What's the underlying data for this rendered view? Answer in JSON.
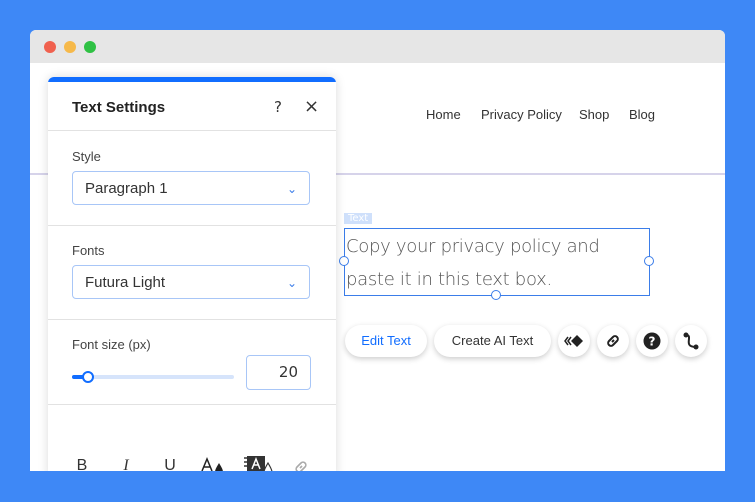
{
  "browser": {
    "controls": [
      "close",
      "minimize",
      "maximize"
    ]
  },
  "site": {
    "nav": [
      "Home",
      "Privacy Policy",
      "Shop",
      "Blog"
    ],
    "text_label": "Text",
    "text_content": "Copy your privacy policy and paste it in this text box.",
    "toolbar": {
      "edit_text": "Edit Text",
      "create_ai_text": "Create AI Text",
      "icons": [
        "animation-icon",
        "link-icon",
        "help-icon",
        "connect-icon"
      ]
    }
  },
  "panel": {
    "title": "Text Settings",
    "help": "?",
    "close": "×",
    "style": {
      "label": "Style",
      "value": "Paragraph 1"
    },
    "fonts": {
      "label": "Fonts",
      "value": "Futura Light"
    },
    "font_size": {
      "label": "Font size (px)",
      "value": "20",
      "slider_fraction": 0.1
    },
    "format": {
      "bold": "B",
      "italic": "I",
      "underline": "U"
    }
  },
  "colors": {
    "accent": "#116dff",
    "background": "#3e88f6"
  }
}
